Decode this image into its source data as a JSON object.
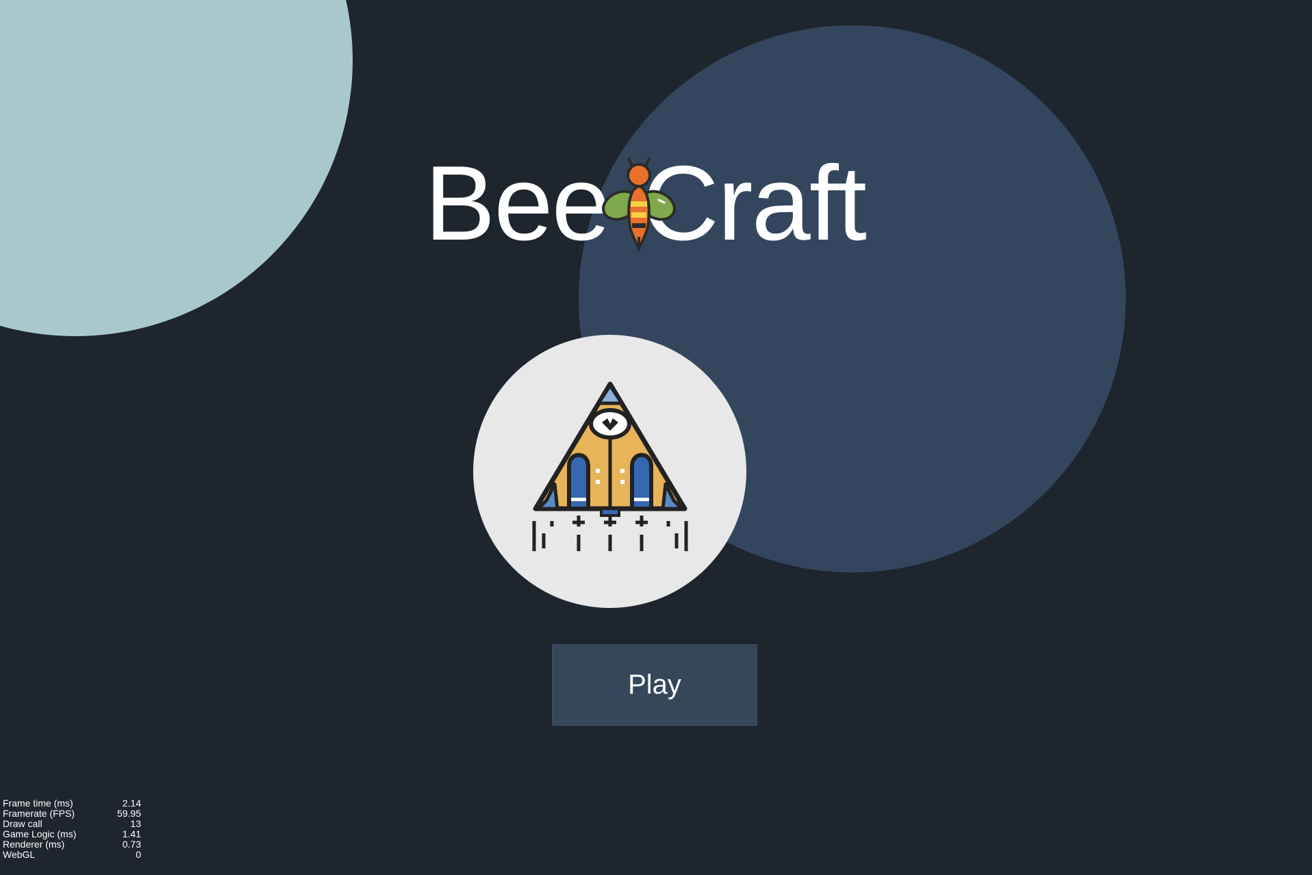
{
  "game": {
    "title_part1": "Bee",
    "title_part2": "Craft",
    "play_label": "Play"
  },
  "colors": {
    "background": "#1f252d",
    "circle_light": "#a8c8cc",
    "circle_navy": "#34465e",
    "badge": "#e8e8e8",
    "button": "#36475a",
    "text": "#ffffff"
  },
  "icons": {
    "logo_bee": "bee-icon",
    "ship": "spaceship-icon"
  },
  "stats": [
    {
      "label": "Frame time (ms)",
      "value": "2.14"
    },
    {
      "label": "Framerate (FPS)",
      "value": "59.95"
    },
    {
      "label": "Draw call",
      "value": "13"
    },
    {
      "label": "Game Logic (ms)",
      "value": "1.41"
    },
    {
      "label": "Renderer (ms)",
      "value": "0.73"
    },
    {
      "label": "WebGL",
      "value": "0"
    }
  ]
}
